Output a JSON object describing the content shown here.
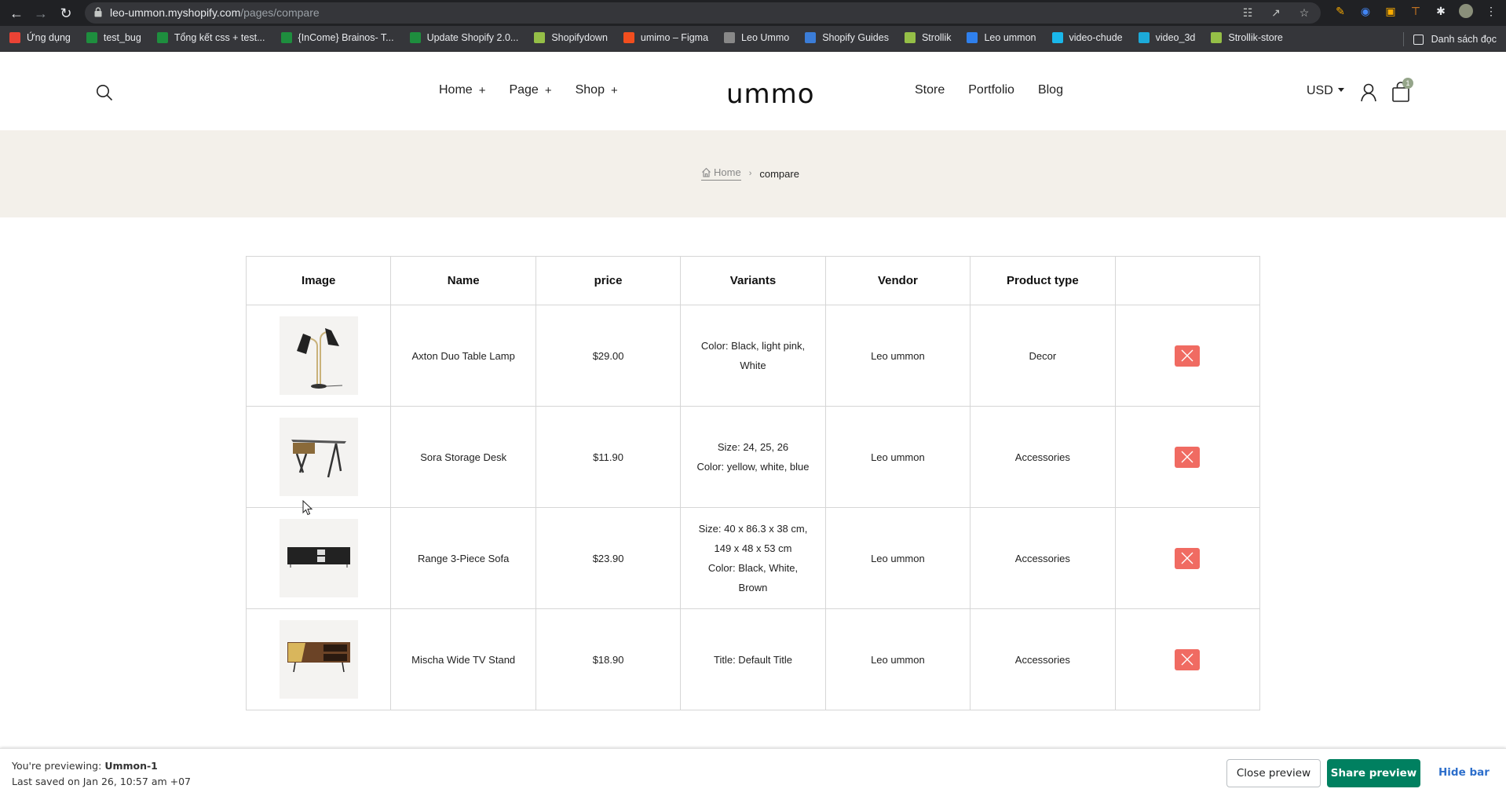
{
  "browser": {
    "url_domain": "leo-ummon.myshopify.com",
    "url_path": "/pages/compare",
    "bookmarks": [
      {
        "label": "Ứng dụng",
        "icon": "apps-grid-icon",
        "color": "#ea4335"
      },
      {
        "label": "test_bug",
        "icon": "sheets-icon",
        "color": "#1e8e3e"
      },
      {
        "label": "Tổng kết css + test...",
        "icon": "sheets-icon",
        "color": "#1e8e3e"
      },
      {
        "label": "{InCome} Brainos- T...",
        "icon": "sheets-icon",
        "color": "#1e8e3e"
      },
      {
        "label": "Update Shopify 2.0...",
        "icon": "sheets-icon",
        "color": "#1e8e3e"
      },
      {
        "label": "Shopifydown",
        "icon": "shopify-icon",
        "color": "#95bf47"
      },
      {
        "label": "umimo – Figma",
        "icon": "figma-icon",
        "color": "#f24e1e"
      },
      {
        "label": "Leo Ummo",
        "icon": "leo-icon",
        "color": "#888888"
      },
      {
        "label": "Shopify Guides",
        "icon": "guides-icon",
        "color": "#3b7dd8"
      },
      {
        "label": "Strollik",
        "icon": "strollik-icon",
        "color": "#95bf47"
      },
      {
        "label": "Leo ummon",
        "icon": "leo-ummon-icon",
        "color": "#2f80ed"
      },
      {
        "label": "video-chude",
        "icon": "vimeo-icon",
        "color": "#1ab7ea"
      },
      {
        "label": "video_3d",
        "icon": "sketchfab-icon",
        "color": "#1caad9"
      },
      {
        "label": "Strollik-store",
        "icon": "shopify-icon",
        "color": "#95bf47"
      }
    ],
    "reading_list": "Danh sách đọc"
  },
  "header": {
    "logo": "ummo",
    "menu_left": [
      {
        "label": "Home",
        "has_submenu": true
      },
      {
        "label": "Page",
        "has_submenu": true
      },
      {
        "label": "Shop",
        "has_submenu": true
      }
    ],
    "menu_right": [
      {
        "label": "Store"
      },
      {
        "label": "Portfolio"
      },
      {
        "label": "Blog"
      }
    ],
    "plus": "+",
    "currency": "USD",
    "cart_count": "1"
  },
  "breadcrumb": {
    "home": "Home",
    "separator": "›",
    "current": "compare"
  },
  "table": {
    "headers": [
      "Image",
      "Name",
      "price",
      "Variants",
      "Vendor",
      "Product type",
      ""
    ],
    "rows": [
      {
        "image": "table-lamp",
        "name": "Axton Duo Table Lamp",
        "price": "$29.00",
        "variants": [
          "Color: Black, light pink,",
          "White"
        ],
        "vendor": "Leo ummon",
        "type": "Decor"
      },
      {
        "image": "storage-desk",
        "name": "Sora Storage Desk",
        "price": "$11.90",
        "variants": [
          "Size: 24, 25, 26",
          "Color: yellow, white, blue"
        ],
        "vendor": "Leo ummon",
        "type": "Accessories"
      },
      {
        "image": "black-sideboard",
        "name": "Range 3-Piece Sofa",
        "price": "$23.90",
        "variants": [
          "Size: 40 x 86.3 x 38 cm,",
          "149 x 48 x 53 cm",
          "Color: Black, White,",
          "Brown"
        ],
        "vendor": "Leo ummon",
        "type": "Accessories"
      },
      {
        "image": "tv-stand",
        "name": "Mischa Wide TV Stand",
        "price": "$18.90",
        "variants": [
          "Title: Default Title"
        ],
        "vendor": "Leo ummon",
        "type": "Accessories"
      }
    ],
    "remove_color": "#f06b62"
  },
  "preview_bar": {
    "previewing_label": "You're previewing: ",
    "theme_name": "Ummon-1",
    "last_saved": "Last saved on Jan 26, 10:57 am +07",
    "close_label": "Close preview",
    "share_label": "Share preview",
    "hide_label": "Hide bar",
    "share_color": "#008060"
  }
}
